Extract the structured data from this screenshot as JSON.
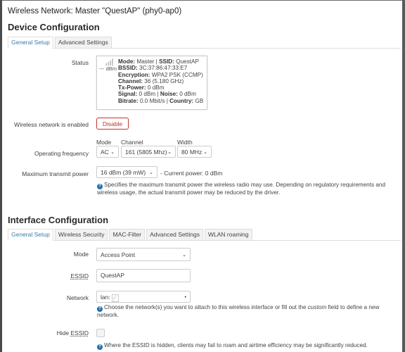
{
  "window": {
    "title": "Wireless Network: Master \"QuestAP\" (phy0-ap0)"
  },
  "device_config": {
    "heading": "Device Configuration",
    "tabs": [
      {
        "label": "General Setup",
        "active": true
      },
      {
        "label": "Advanced Settings",
        "active": false
      }
    ],
    "status": {
      "label": "Status",
      "signal_text": "--- dBm",
      "mode_key": "Mode:",
      "mode_val": " Master | ",
      "ssid_key": "SSID:",
      "ssid_val": " QuestAP",
      "bssid_key": "BSSID:",
      "bssid_val": " 3C:37:86:47:33:E7",
      "enc_key": "Encryption:",
      "enc_val": " WPA2 PSK (CCMP)",
      "channel_key": "Channel:",
      "channel_val": " 36 (5.180 GHz)",
      "txpower_key": "Tx-Power:",
      "txpower_val": " 0 dBm",
      "signal_key": "Signal:",
      "signal_val": " 0 dBm | ",
      "noise_key": "Noise:",
      "noise_val": " 0 dBm",
      "bitrate_key": "Bitrate:",
      "bitrate_val": " 0.0 Mbit/s | ",
      "country_key": "Country:",
      "country_val": " GB"
    },
    "enabled": {
      "label": "Wireless network is enabled",
      "button": "Disable"
    },
    "frequency": {
      "label": "Operating frequency",
      "mode_label": "Mode",
      "mode_value": "AC",
      "channel_label": "Channel",
      "channel_value": "161 (5805 Mhz)",
      "width_label": "Width",
      "width_value": "80 MHz"
    },
    "tx_power": {
      "label": "Maximum transmit power",
      "value": "16 dBm (39 mW)",
      "current": "- Current power: 0 dBm",
      "help": "Specifies the maximum transmit power the wireless radio may use. Depending on regulatory requirements and wireless usage, the actual transmit power may be reduced by the driver."
    }
  },
  "interface_config": {
    "heading": "Interface Configuration",
    "tabs": [
      {
        "label": "General Setup",
        "active": true
      },
      {
        "label": "Wireless Security",
        "active": false
      },
      {
        "label": "MAC-Filter",
        "active": false
      },
      {
        "label": "Advanced Settings",
        "active": false
      },
      {
        "label": "WLAN roaming",
        "active": false
      }
    ],
    "mode": {
      "label": "Mode",
      "value": "Access Point"
    },
    "essid": {
      "label": "ESSID",
      "value": "QuestAP"
    },
    "network": {
      "label": "Network",
      "value": "lan:",
      "help_pre": "Choose the network(s) you want to attach to this wireless interface or fill out the ",
      "help_em": "custom",
      "help_post": " field to define a new network."
    },
    "hide_essid": {
      "label_pre": "Hide ",
      "label_u": "ESSID",
      "checked": false,
      "help": "Where the ESSID is hidden, clients may fail to roam and airtime efficiency may be significantly reduced."
    }
  },
  "icons": {
    "help": "?",
    "chevron": "⌄",
    "dropdown_dot": "•"
  }
}
